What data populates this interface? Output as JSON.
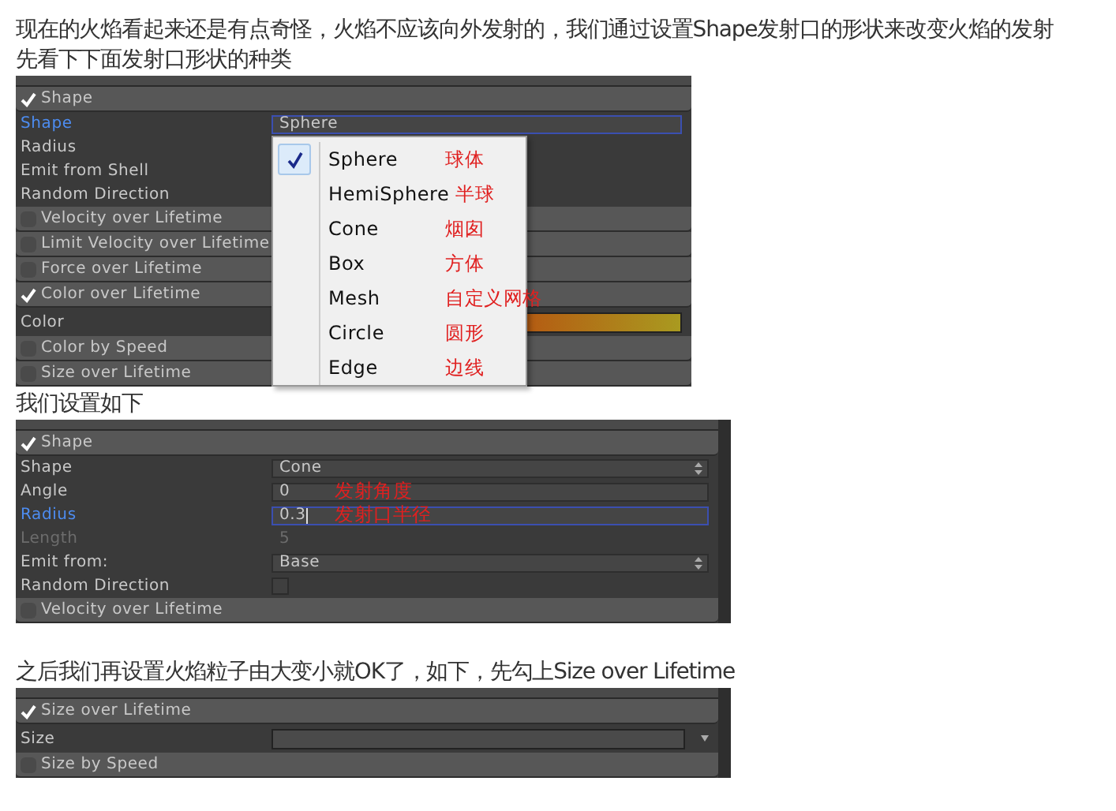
{
  "sections": [
    {
      "kind": "text",
      "text": "现在的火焰看起来还是有点奇怪，火焰不应该向外发射的，我们通过设置Shape发射口的形状来改变火焰的发射"
    },
    {
      "kind": "text",
      "text": "先看下下面发射口形状的种类"
    },
    {
      "kind": "panel",
      "rows": [
        {
          "kind": "header",
          "label": "Shape",
          "checked": true
        },
        {
          "kind": "property",
          "label": "Shape",
          "focused": true,
          "field": {
            "kind": "dropdown",
            "value": "Sphere"
          }
        },
        {
          "kind": "property",
          "label": "Radius",
          "focused": false
        },
        {
          "kind": "property",
          "label": "Emit from Shell",
          "focused": false
        },
        {
          "kind": "property",
          "label": "Random Direction",
          "focused": false
        },
        {
          "kind": "header",
          "label": "Velocity over Lifetime",
          "checked": false
        },
        {
          "kind": "header",
          "label": "Limit Velocity over Lifetime",
          "checked": false
        },
        {
          "kind": "header",
          "label": "Force over Lifetime",
          "checked": false
        },
        {
          "kind": "header",
          "label": "Color over Lifetime",
          "checked": true
        },
        {
          "kind": "property",
          "label": "Color",
          "focused": false,
          "field": {
            "kind": "gradient"
          }
        },
        {
          "kind": "header",
          "label": "Color by Speed",
          "checked": false
        },
        {
          "kind": "header",
          "label": "Size over Lifetime",
          "checked": false
        }
      ],
      "menu": {
        "items": [
          {
            "label": "Sphere",
            "note": "球体",
            "selected": true
          },
          {
            "label": "HemiSphere",
            "note": "半球",
            "selected": false
          },
          {
            "label": "Cone",
            "note": "烟囱",
            "selected": false
          },
          {
            "label": "Box",
            "note": "方体",
            "selected": false
          },
          {
            "label": "Mesh",
            "note": "自定义网格",
            "selected": false
          },
          {
            "label": "Circle",
            "note": "圆形",
            "selected": false
          },
          {
            "label": "Edge",
            "note": "边线",
            "selected": false
          }
        ]
      }
    },
    {
      "kind": "text",
      "text": "我们设置如下"
    },
    {
      "kind": "panel",
      "rows": [
        {
          "kind": "header",
          "label": "Shape",
          "checked": true
        },
        {
          "kind": "property",
          "label": "Shape",
          "focused": false,
          "field": {
            "kind": "dropdown",
            "value": "Cone"
          }
        },
        {
          "kind": "property",
          "label": "Angle",
          "focused": false,
          "field": {
            "kind": "number",
            "value": "0"
          },
          "note": "发射角度"
        },
        {
          "kind": "property",
          "label": "Radius",
          "focused": true,
          "field": {
            "kind": "number",
            "value": "0.3"
          },
          "note": "发射口半径"
        },
        {
          "kind": "property",
          "label": "Length",
          "focused": false,
          "disabled": true,
          "field": {
            "kind": "number",
            "value": "5"
          }
        },
        {
          "kind": "property",
          "label": "Emit from:",
          "focused": false,
          "field": {
            "kind": "dropdown",
            "value": "Base"
          }
        },
        {
          "kind": "property",
          "label": "Random Direction",
          "focused": false,
          "field": {
            "kind": "checkbox",
            "checked": false
          }
        },
        {
          "kind": "header",
          "label": "Velocity over Lifetime",
          "checked": false
        }
      ]
    },
    {
      "kind": "text",
      "text": "之后我们再设置火焰粒子由大变小就OK了，如下，先勾上Size over Lifetime"
    },
    {
      "kind": "panel",
      "rows": [
        {
          "kind": "header",
          "label": "Size over Lifetime",
          "checked": true
        },
        {
          "kind": "property",
          "label": "Size",
          "focused": false,
          "field": {
            "kind": "curve"
          }
        },
        {
          "kind": "header",
          "label": "Size by Speed",
          "checked": false
        }
      ]
    }
  ]
}
